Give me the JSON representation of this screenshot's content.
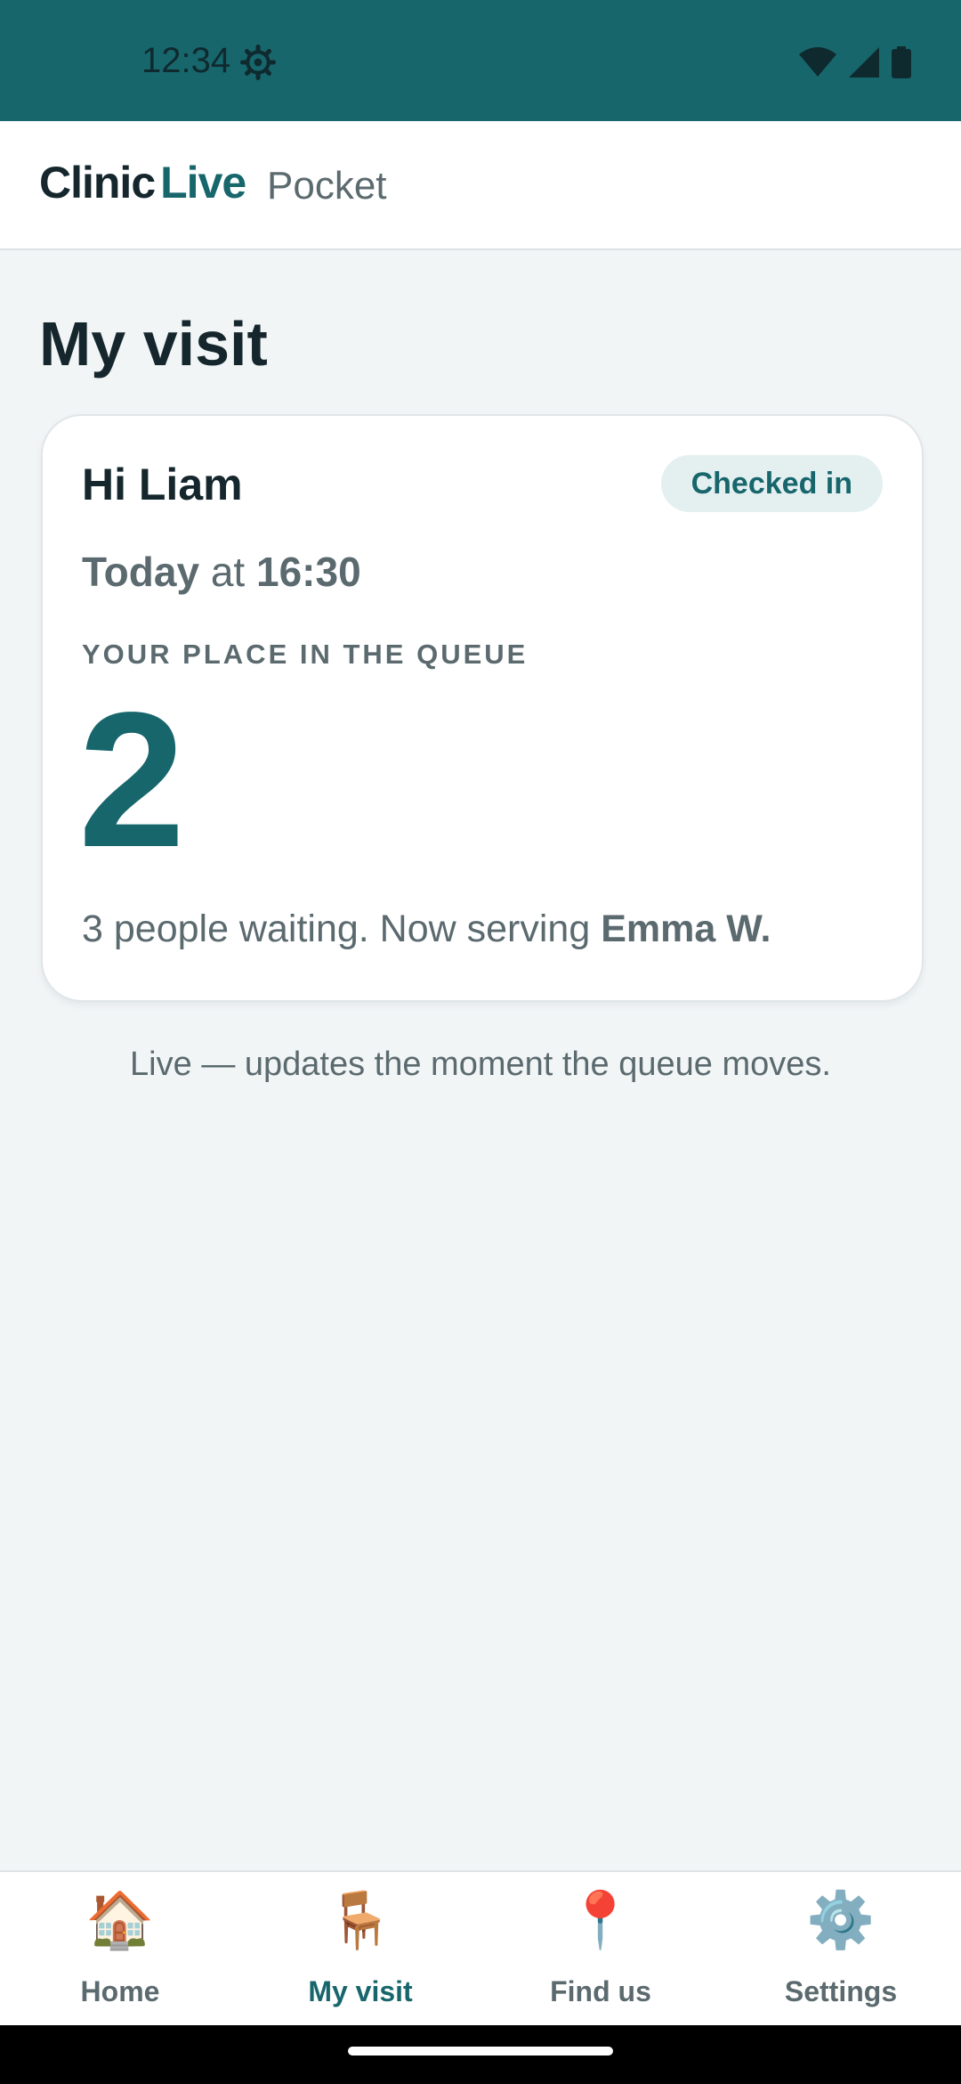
{
  "status_bar": {
    "time": "12:34"
  },
  "app_bar": {
    "brand_part1": "Clinic",
    "brand_part2": "Live",
    "subtitle": "Pocket"
  },
  "page": {
    "title": "My visit"
  },
  "card": {
    "greeting": "Hi Liam",
    "badge": "Checked in",
    "when_day": "Today",
    "when_at": "at",
    "when_time": "16:30",
    "queue_label": "YOUR PLACE IN THE QUEUE",
    "queue_position": "2",
    "waiting_text": "3 people waiting. Now serving",
    "serving_name": "Emma W."
  },
  "live_note": "Live — updates the moment the queue moves.",
  "bottom_nav": {
    "items": [
      {
        "label": "Home",
        "icon": "🏠",
        "icon_name": "house-icon"
      },
      {
        "label": "My visit",
        "icon": "🪑",
        "icon_name": "chair-icon",
        "active": true
      },
      {
        "label": "Find us",
        "icon": "📍",
        "icon_name": "location-pin-icon"
      },
      {
        "label": "Settings",
        "icon": "⚙️",
        "icon_name": "gear-icon"
      }
    ]
  },
  "colors": {
    "accent": "#17666c",
    "status_bar": "#17666c",
    "background": "#f1f5f6",
    "badge_bg": "#e4eff0"
  }
}
